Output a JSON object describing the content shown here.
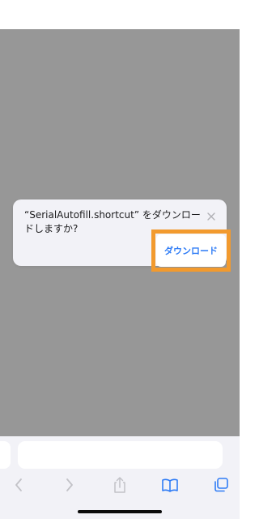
{
  "dialog": {
    "message": "“SerialAutofill.shortcut” をダウンロードしますか?",
    "download_label": "ダウンロード",
    "close_icon": "close-icon"
  },
  "toolbar": {
    "icons": [
      "back-chevron-icon",
      "forward-chevron-icon",
      "share-icon",
      "bookmarks-icon",
      "tabs-icon"
    ]
  },
  "colors": {
    "overlay": "#979797",
    "accent": "#2f7cf6",
    "highlight": "#f29a2e",
    "dialog_bg": "#f2f2f7"
  }
}
